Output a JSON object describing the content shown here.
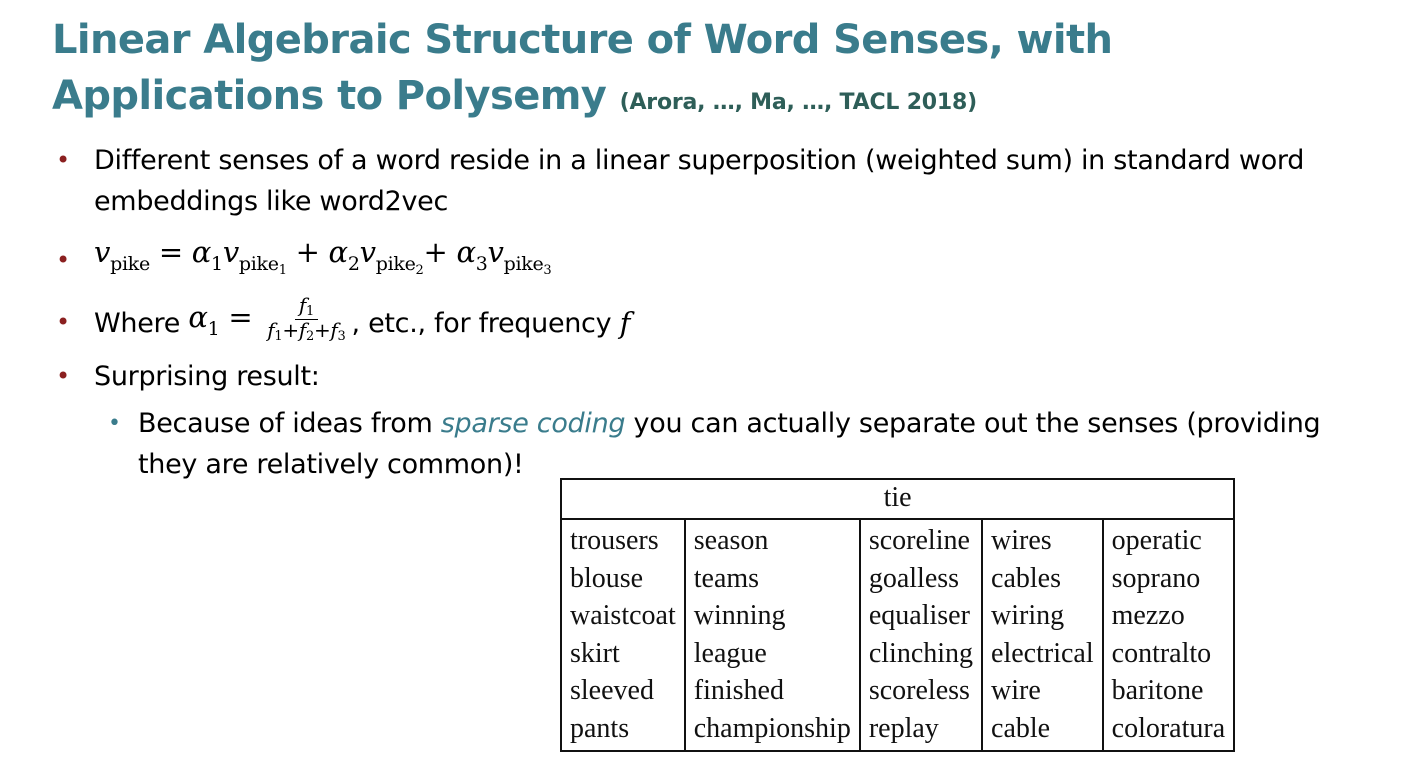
{
  "slide": {
    "title": "Linear Algebraic Structure of Word Senses, with Applications to Polysemy",
    "citation": "(Arora, …, Ma, …, TACL 2018)"
  },
  "bullets": {
    "b1": "Different senses of a word reside in a linear superposition (weighted sum) in standard word embeddings like word2vec",
    "b3_prefix": "Where",
    "b3_suffix": ", etc., for frequency",
    "b3_var": "f",
    "b4": "Surprising result:",
    "sub_before": "Because of ideas from",
    "sub_em": "sparse coding",
    "sub_after": "you can actually separate out the senses (providing they are relatively common)!"
  },
  "equation": {
    "v": "v",
    "pike": "pike",
    "eq": "=",
    "plus": "+",
    "alpha": "α",
    "n1": "1",
    "n2": "2",
    "n3": "3"
  },
  "fraction": {
    "f": "f",
    "plus": "+"
  },
  "table": {
    "header": "tie",
    "rows": [
      [
        "trousers",
        "season",
        "scoreline",
        "wires",
        "operatic"
      ],
      [
        "blouse",
        "teams",
        "goalless",
        "cables",
        "soprano"
      ],
      [
        "waistcoat",
        "winning",
        "equaliser",
        "wiring",
        "mezzo"
      ],
      [
        "skirt",
        "league",
        "clinching",
        "electrical",
        "contralto"
      ],
      [
        "sleeved",
        "finished",
        "scoreless",
        "wire",
        "baritone"
      ],
      [
        "pants",
        "championship",
        "replay",
        "cable",
        "coloratura"
      ]
    ]
  },
  "colors": {
    "title": "#3a7c8c",
    "citation": "#2e5e58",
    "bullet": "#8b2020",
    "sub_bullet": "#3a7c8c"
  }
}
